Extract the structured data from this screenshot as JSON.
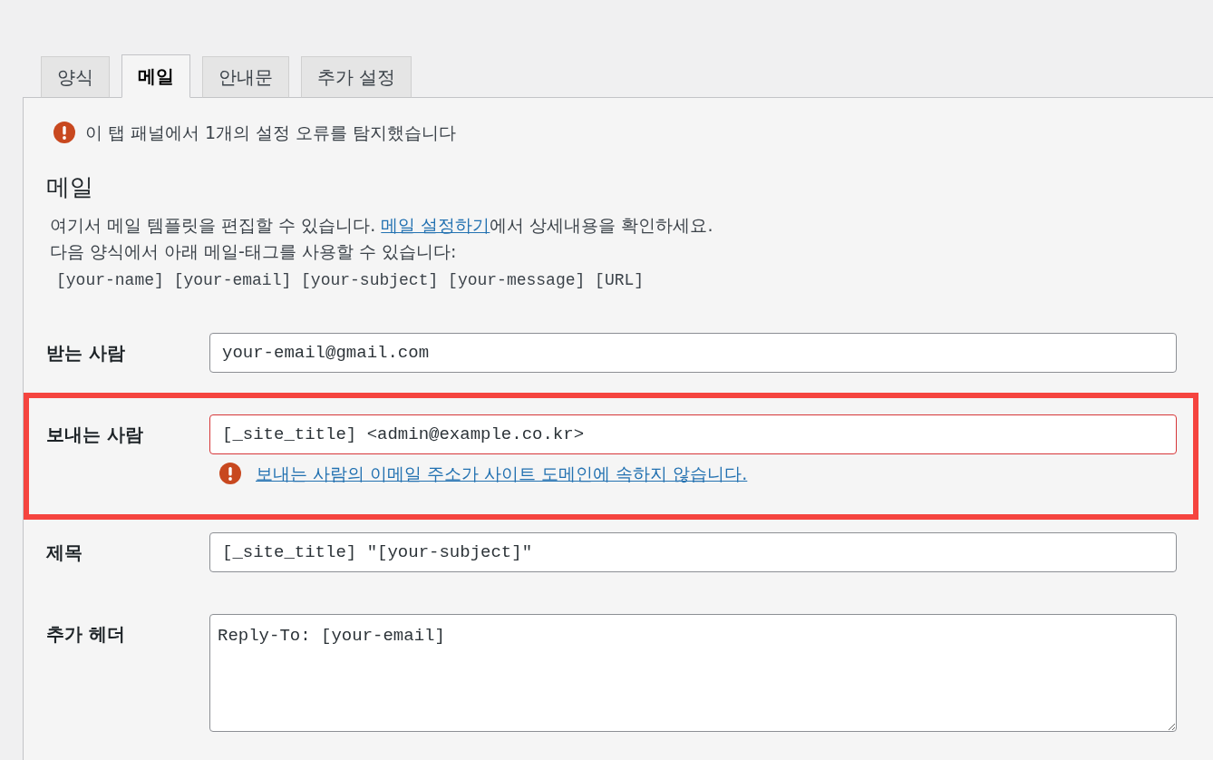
{
  "tabs": [
    {
      "label": "양식",
      "selected": false
    },
    {
      "label": "메일",
      "selected": true
    },
    {
      "label": "안내문",
      "selected": false
    },
    {
      "label": "추가 설정",
      "selected": false
    }
  ],
  "notice": {
    "kind": "error",
    "text": "이 탭 패널에서 1개의 설정 오류를 탐지했습니다"
  },
  "section": {
    "title": "메일",
    "description_before": "여기서 메일 템플릿을 편집할 수 있습니다. ",
    "link": "메일 설정하기",
    "description_after": "에서 상세내용을 확인하세요.",
    "hint": "다음 양식에서 아래 메일-태그를 사용할 수 있습니다:",
    "tags": [
      "[your-name]",
      "[your-email]",
      "[your-subject]",
      "[your-message]",
      "[URL]"
    ]
  },
  "fields": [
    {
      "label": "받는 사람",
      "kind": "input",
      "value": "your-email@gmail.com",
      "invalid": false,
      "highlighted": false
    },
    {
      "label": "보내는 사람",
      "kind": "input",
      "value": "[_site_title] <admin@example.co.kr>",
      "invalid": true,
      "highlighted": true,
      "error": "보내는 사람의 이메일 주소가 사이트 도메인에 속하지 않습니다."
    },
    {
      "label": "제목",
      "kind": "input",
      "value": "[_site_title] \"[your-subject]\"",
      "invalid": false,
      "highlighted": false
    },
    {
      "label": "추가 헤더",
      "kind": "textarea",
      "value": "Reply-To: [your-email]",
      "invalid": false,
      "highlighted": false
    }
  ]
}
